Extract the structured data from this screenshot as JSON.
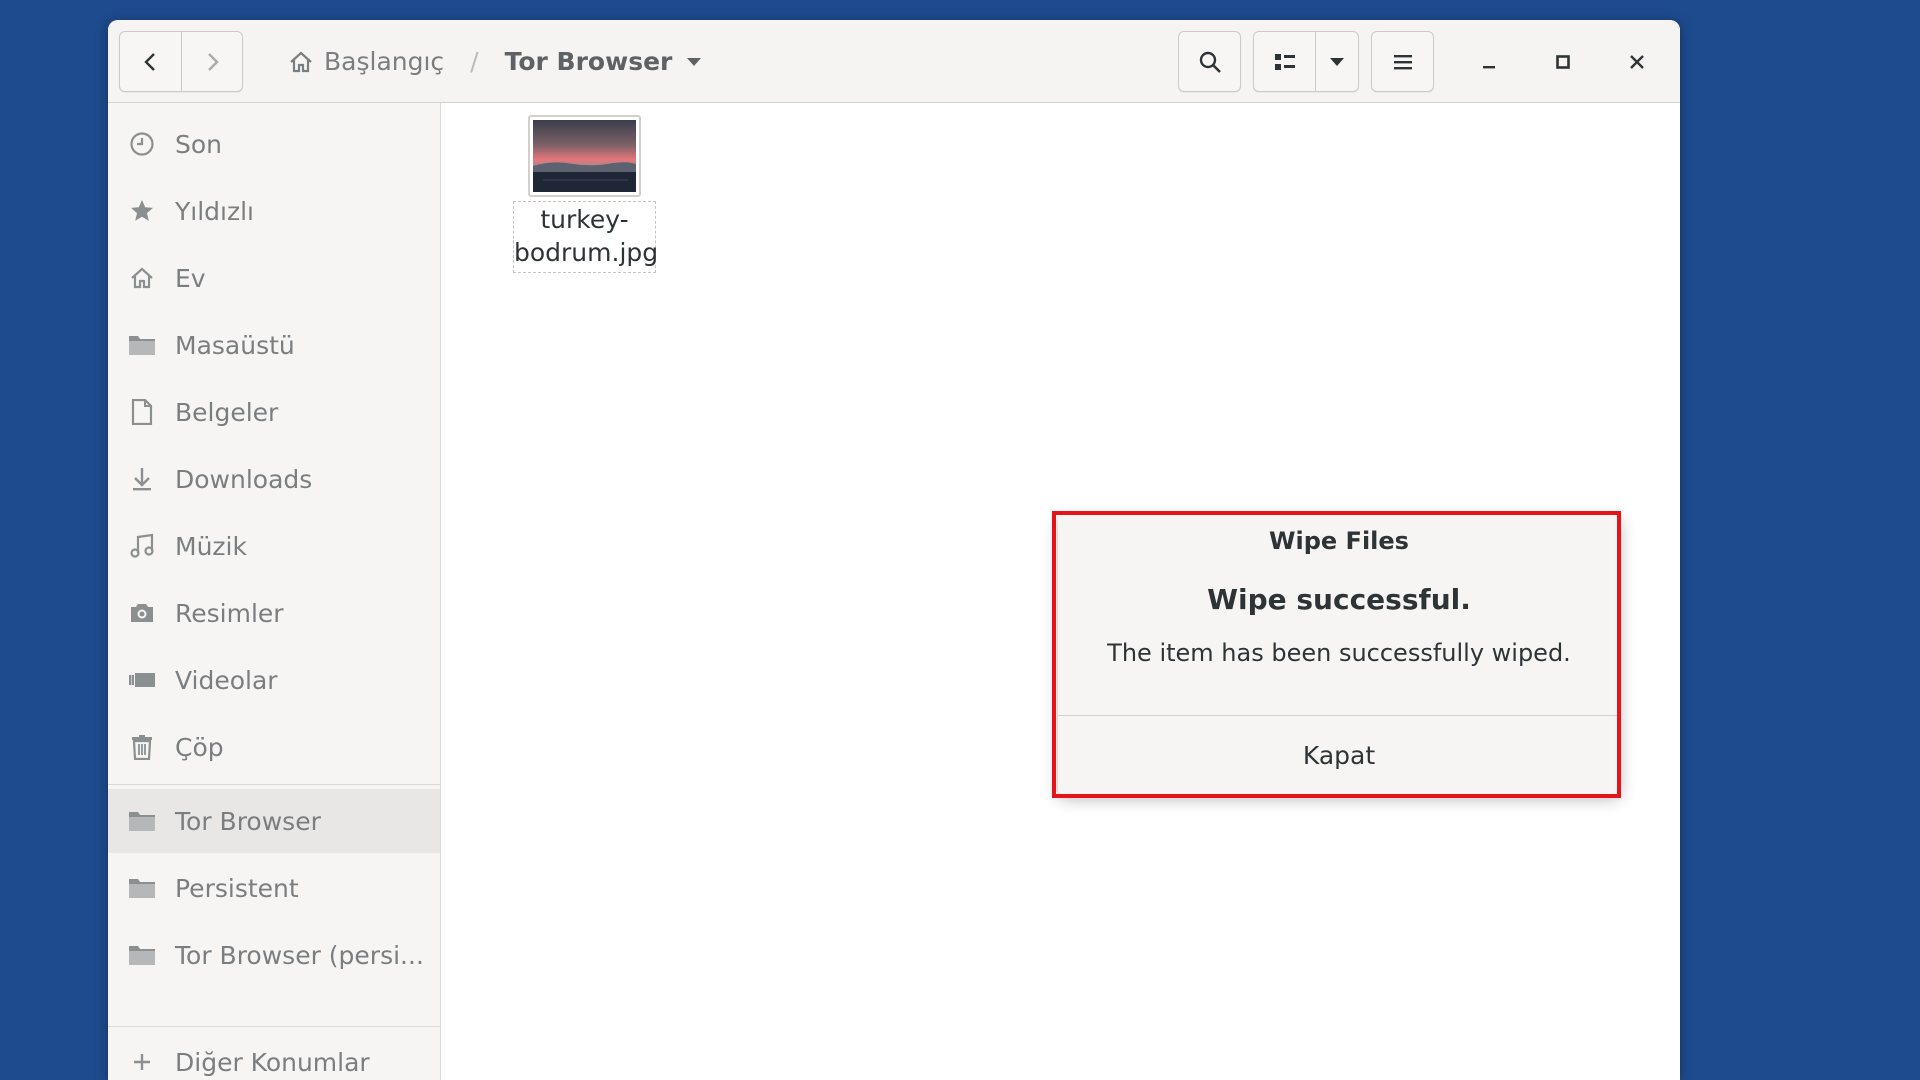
{
  "colors": {
    "desktop": "#1e4b8d",
    "highlight": "#e5141b",
    "sidebar_bg": "#f6f5f4",
    "text": "#2e3436",
    "muted_text": "#7b7e80"
  },
  "toolbar": {
    "back_icon": "chevron-left-icon",
    "forward_icon": "chevron-right-icon",
    "search_icon": "search-icon",
    "view_icon": "list-view-icon",
    "view_dropdown_icon": "chevron-down-icon",
    "menu_icon": "hamburger-menu-icon",
    "minimize_icon": "minimize-icon",
    "maximize_icon": "maximize-icon",
    "close_icon": "close-icon"
  },
  "path": {
    "home_label": "Başlangıç",
    "separator": "/",
    "current_label": "Tor Browser"
  },
  "sidebar": {
    "places": [
      {
        "label": "Son",
        "icon": "clock-icon"
      },
      {
        "label": "Yıldızlı",
        "icon": "star-icon"
      },
      {
        "label": "Ev",
        "icon": "home-icon"
      },
      {
        "label": "Masaüstü",
        "icon": "folder-icon"
      },
      {
        "label": "Belgeler",
        "icon": "document-icon"
      },
      {
        "label": "Downloads",
        "icon": "download-icon"
      },
      {
        "label": "Müzik",
        "icon": "music-icon"
      },
      {
        "label": "Resimler",
        "icon": "camera-icon"
      },
      {
        "label": "Videolar",
        "icon": "video-icon"
      },
      {
        "label": "Çöp",
        "icon": "trash-icon"
      }
    ],
    "bookmarks": [
      {
        "label": "Tor Browser",
        "icon": "folder-icon",
        "active": true
      },
      {
        "label": "Persistent",
        "icon": "folder-icon"
      },
      {
        "label": "Tor Browser (persi...",
        "icon": "folder-icon"
      }
    ],
    "other_locations": {
      "label": "Diğer Konumlar",
      "icon": "plus-icon"
    }
  },
  "files": [
    {
      "name_line1": "turkey-",
      "name_line2": "bodrum.jpg",
      "icon": "image-thumbnail"
    }
  ],
  "dialog": {
    "title": "Wipe Files",
    "heading": "Wipe successful.",
    "message": "The item has been successfully wiped.",
    "button_label": "Kapat"
  }
}
